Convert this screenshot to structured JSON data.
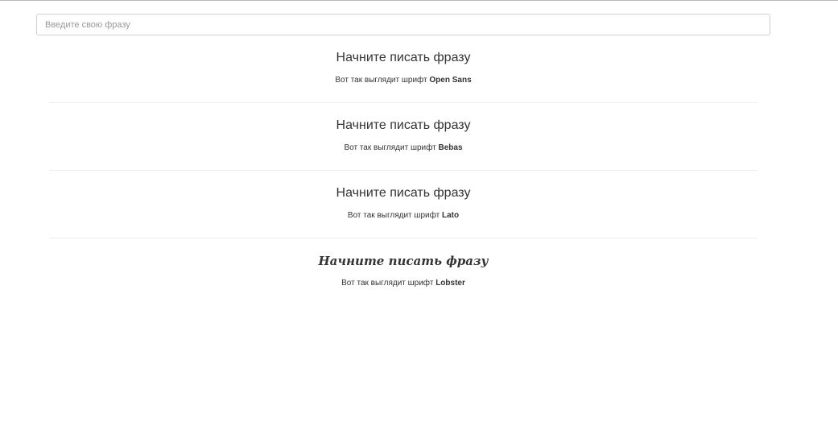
{
  "search": {
    "placeholder": "Введите свою фразу",
    "value": ""
  },
  "previews": [
    {
      "phrase": "Начните писать фразу",
      "caption_prefix": "Вот так выглядит шрифт",
      "font_name": "Open Sans"
    },
    {
      "phrase": "Начните писать фразу",
      "caption_prefix": "Вот так выглядит шрифт",
      "font_name": "Bebas"
    },
    {
      "phrase": "Начните писать фразу",
      "caption_prefix": "Вот так выглядит шрифт",
      "font_name": "Lato"
    },
    {
      "phrase": "Начните писать фразу",
      "caption_prefix": "Вот так выглядит шрифт",
      "font_name": "Lobster"
    }
  ],
  "colors": {
    "text": "#333333",
    "input_border": "#cfcfcf",
    "divider": "#eeeeee"
  }
}
